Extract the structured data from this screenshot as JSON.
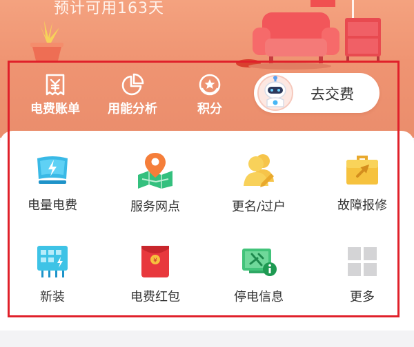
{
  "header": {
    "days_text": "预计可用163天"
  },
  "quick_actions": [
    {
      "label": "电费账单",
      "icon": "bill-icon"
    },
    {
      "label": "用能分析",
      "icon": "pie-chart-icon"
    },
    {
      "label": "积分",
      "icon": "points-icon"
    }
  ],
  "pay": {
    "label": "去交费",
    "icon": "robot-avatar-icon"
  },
  "services": [
    {
      "label": "电量电费",
      "icon": "electricity-fee-icon"
    },
    {
      "label": "服务网点",
      "icon": "service-map-icon"
    },
    {
      "label": "更名/过户",
      "icon": "rename-transfer-icon"
    },
    {
      "label": "故障报修",
      "icon": "repair-toolbox-icon"
    },
    {
      "label": "新装",
      "icon": "new-install-icon"
    },
    {
      "label": "电费红包",
      "icon": "red-envelope-icon"
    },
    {
      "label": "停电信息",
      "icon": "outage-info-icon"
    },
    {
      "label": "更多",
      "icon": "more-grid-icon"
    }
  ],
  "colors": {
    "hero": "#ef9472",
    "highlight_border": "#e0202a",
    "card": "#ffffff"
  }
}
